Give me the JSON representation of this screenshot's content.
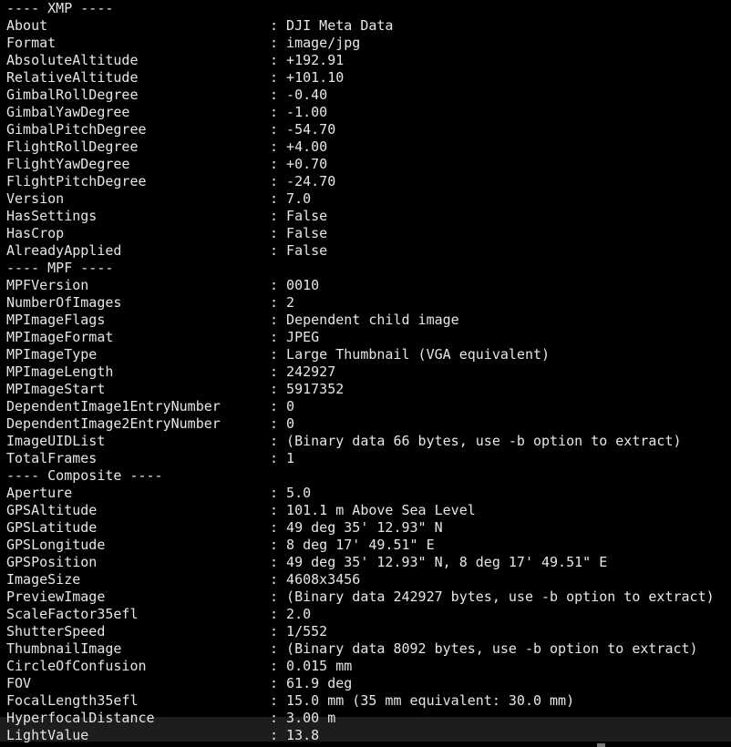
{
  "rows": [
    {
      "section": "---- XMP ----"
    },
    {
      "label": "About",
      "value": "DJI Meta Data"
    },
    {
      "label": "Format",
      "value": "image/jpg"
    },
    {
      "label": "AbsoluteAltitude",
      "value": "+192.91"
    },
    {
      "label": "RelativeAltitude",
      "value": "+101.10"
    },
    {
      "label": "GimbalRollDegree",
      "value": "-0.40"
    },
    {
      "label": "GimbalYawDegree",
      "value": "-1.00"
    },
    {
      "label": "GimbalPitchDegree",
      "value": "-54.70"
    },
    {
      "label": "FlightRollDegree",
      "value": "+4.00"
    },
    {
      "label": "FlightYawDegree",
      "value": "+0.70"
    },
    {
      "label": "FlightPitchDegree",
      "value": "-24.70"
    },
    {
      "label": "Version",
      "value": "7.0"
    },
    {
      "label": "HasSettings",
      "value": "False"
    },
    {
      "label": "HasCrop",
      "value": "False"
    },
    {
      "label": "AlreadyApplied",
      "value": "False"
    },
    {
      "section": "---- MPF ----"
    },
    {
      "label": "MPFVersion",
      "value": "0010"
    },
    {
      "label": "NumberOfImages",
      "value": "2"
    },
    {
      "label": "MPImageFlags",
      "value": "Dependent child image"
    },
    {
      "label": "MPImageFormat",
      "value": "JPEG"
    },
    {
      "label": "MPImageType",
      "value": "Large Thumbnail (VGA equivalent)"
    },
    {
      "label": "MPImageLength",
      "value": "242927"
    },
    {
      "label": "MPImageStart",
      "value": "5917352"
    },
    {
      "label": "DependentImage1EntryNumber",
      "value": "0"
    },
    {
      "label": "DependentImage2EntryNumber",
      "value": "0"
    },
    {
      "label": "ImageUIDList",
      "value": "(Binary data 66 bytes, use -b option to extract)"
    },
    {
      "label": "TotalFrames",
      "value": "1"
    },
    {
      "section": "---- Composite ----"
    },
    {
      "label": "Aperture",
      "value": "5.0"
    },
    {
      "label": "GPSAltitude",
      "value": "101.1 m Above Sea Level"
    },
    {
      "label": "GPSLatitude",
      "value": "49 deg 35' 12.93\" N"
    },
    {
      "label": "GPSLongitude",
      "value": "8 deg 17' 49.51\" E"
    },
    {
      "label": "GPSPosition",
      "value": "49 deg 35' 12.93\" N, 8 deg 17' 49.51\" E"
    },
    {
      "label": "ImageSize",
      "value": "4608x3456"
    },
    {
      "label": "PreviewImage",
      "value": "(Binary data 242927 bytes, use -b option to extract)"
    },
    {
      "label": "ScaleFactor35efl",
      "value": "2.0"
    },
    {
      "label": "ShutterSpeed",
      "value": "1/552"
    },
    {
      "label": "ThumbnailImage",
      "value": "(Binary data 8092 bytes, use -b option to extract)"
    },
    {
      "label": "CircleOfConfusion",
      "value": "0.015 mm"
    },
    {
      "label": "FOV",
      "value": "61.9 deg"
    },
    {
      "label": "FocalLength35efl",
      "value": "15.0 mm (35 mm equivalent: 30.0 mm)"
    },
    {
      "label": "HyperfocalDistance",
      "value": "3.00 m"
    },
    {
      "label": "LightValue",
      "value": "13.8"
    }
  ],
  "separator": ": ",
  "colors": {
    "background": "#000000",
    "text": "#e6e6e6",
    "highlight": "#1d1d1d"
  }
}
